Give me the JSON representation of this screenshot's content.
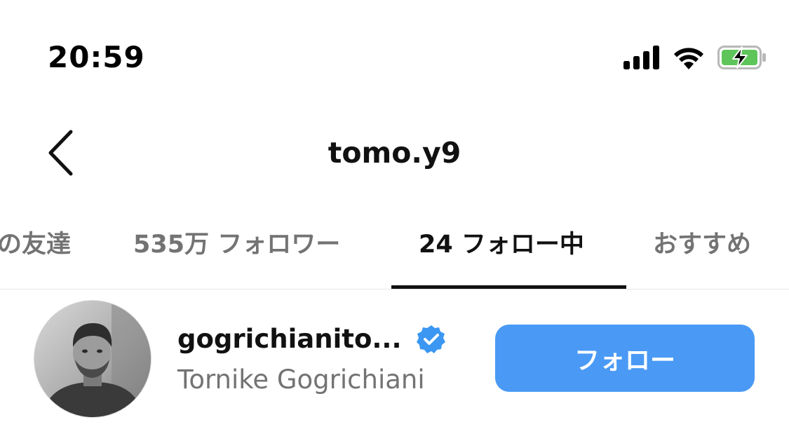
{
  "status_bar": {
    "time": "20:59",
    "icons": [
      "cellular-signal-icon",
      "wifi-icon",
      "battery-charging-icon"
    ]
  },
  "header": {
    "back_icon": "chevron-left-icon",
    "title": "tomo.y9"
  },
  "tabs": [
    {
      "label": "の友達",
      "active": false
    },
    {
      "label": "535万 フォロワー",
      "active": false
    },
    {
      "label": "24 フォロー中",
      "active": true
    },
    {
      "label": "おすすめ",
      "active": false
    }
  ],
  "following_list": [
    {
      "username": "gogrichianito...",
      "verified": true,
      "full_name": "Tornike Gogrichiani",
      "action_label": "フォロー"
    }
  ],
  "colors": {
    "accent": "#4a9af5",
    "verified": "#3b97f2",
    "battery_fill": "#5ec55a",
    "secondary_text": "#737373"
  }
}
